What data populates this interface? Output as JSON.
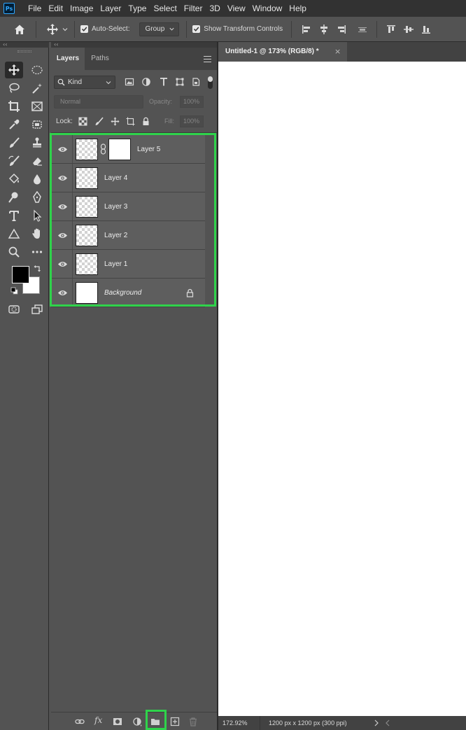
{
  "app": {
    "logo": "Ps",
    "menu": [
      "File",
      "Edit",
      "Image",
      "Layer",
      "Type",
      "Select",
      "Filter",
      "3D",
      "View",
      "Window",
      "Help"
    ]
  },
  "options": {
    "auto_select_label": "Auto-Select:",
    "auto_select_checked": true,
    "auto_select_target": "Group",
    "show_transform_label": "Show Transform Controls",
    "show_transform_checked": true
  },
  "collapse_glyph": "‹‹",
  "toolbar": {
    "tools": [
      {
        "name": "move-tool",
        "active": true
      },
      {
        "name": "elliptical-marquee-tool"
      },
      {
        "name": "lasso-tool"
      },
      {
        "name": "magic-wand-tool"
      },
      {
        "name": "crop-tool"
      },
      {
        "name": "frame-tool"
      },
      {
        "name": "eyedropper-tool"
      },
      {
        "name": "patch-tool"
      },
      {
        "name": "brush-tool"
      },
      {
        "name": "clone-stamp-tool"
      },
      {
        "name": "history-brush-tool"
      },
      {
        "name": "eraser-tool"
      },
      {
        "name": "paint-bucket-tool"
      },
      {
        "name": "blur-tool"
      },
      {
        "name": "dodge-tool"
      },
      {
        "name": "pen-tool"
      },
      {
        "name": "type-tool"
      },
      {
        "name": "path-selection-tool"
      },
      {
        "name": "shape-tool"
      },
      {
        "name": "hand-tool"
      },
      {
        "name": "zoom-tool"
      },
      {
        "name": "more-tools"
      }
    ],
    "foreground_color": "#000000",
    "background_color": "#ffffff"
  },
  "layers_panel": {
    "tabs": [
      {
        "label": "Layers",
        "active": true
      },
      {
        "label": "Paths",
        "active": false
      }
    ],
    "filter_kind": "Kind",
    "blend_mode": "Normal",
    "opacity_label": "Opacity:",
    "opacity_value": "100%",
    "lock_label": "Lock:",
    "fill_label": "Fill:",
    "fill_value": "100%",
    "layers": [
      {
        "name": "Layer 5",
        "visible": true,
        "has_mask": true,
        "thumb": "transparent"
      },
      {
        "name": "Layer 4",
        "visible": true,
        "thumb": "transparent"
      },
      {
        "name": "Layer 3",
        "visible": true,
        "thumb": "transparent"
      },
      {
        "name": "Layer 2",
        "visible": true,
        "thumb": "transparent"
      },
      {
        "name": "Layer 1",
        "visible": true,
        "thumb": "transparent"
      },
      {
        "name": "Background",
        "visible": true,
        "locked": true,
        "italic": true,
        "thumb": "white"
      }
    ],
    "footer_fx": "fx"
  },
  "document": {
    "tab_title": "Untitled-1 @ 173% (RGB/8) *",
    "close_glyph": "×",
    "zoom": "172.92%",
    "info": "1200 px x 1200 px (300 ppi)"
  },
  "highlight_color": "#2fd34b"
}
